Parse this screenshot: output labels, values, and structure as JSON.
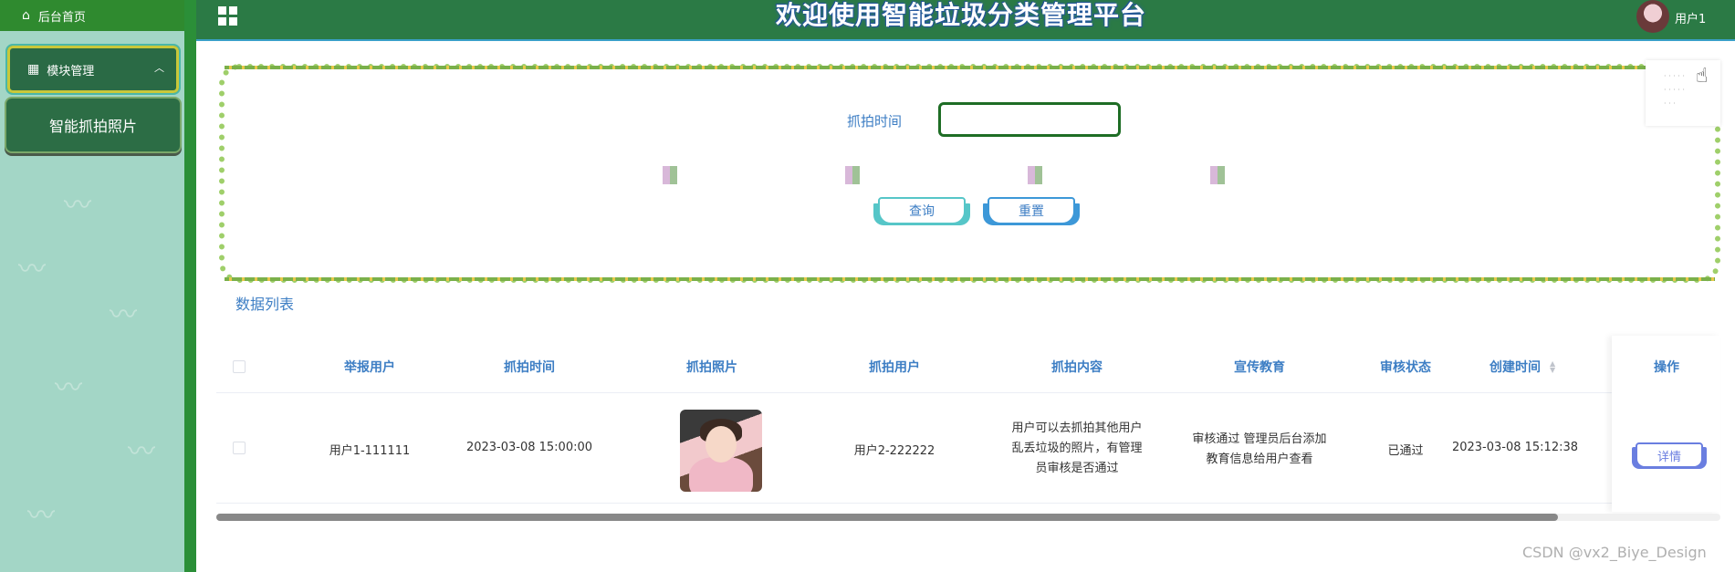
{
  "sidebar": {
    "home_label": "后台首页",
    "module_label": "模块管理",
    "sub_item_label": "智能抓拍照片"
  },
  "header": {
    "title": "欢迎使用智能垃圾分类管理平台",
    "username": "用户1"
  },
  "search": {
    "time_label": "抓拍时间",
    "time_value": "",
    "query_label": "查询",
    "reset_label": "重置"
  },
  "list": {
    "title": "数据列表",
    "columns": [
      "举报用户",
      "抓拍时间",
      "抓拍照片",
      "抓拍用户",
      "抓拍内容",
      "宣传教育",
      "审核状态",
      "创建时间",
      "操作"
    ],
    "rows": [
      {
        "reporter": "用户1-111111",
        "capture_time": "2023-03-08 15:00:00",
        "captured_user": "用户2-222222",
        "content": "用户可以去抓拍其他用户乱丢垃圾的照片，有管理员审核是否通过",
        "education": "审核通过 管理员后台添加教育信息给用户查看",
        "status": "已通过",
        "created": "2023-03-08 15:12:38",
        "action": "详情"
      }
    ]
  },
  "watermark": "CSDN @vx2_Biye_Design",
  "colors": {
    "header_bg": "#2b7a45",
    "sidebar_bg": "#a3d6c6",
    "accent_text": "#3d7ec4",
    "sidebar_border": "#2b8f38"
  }
}
